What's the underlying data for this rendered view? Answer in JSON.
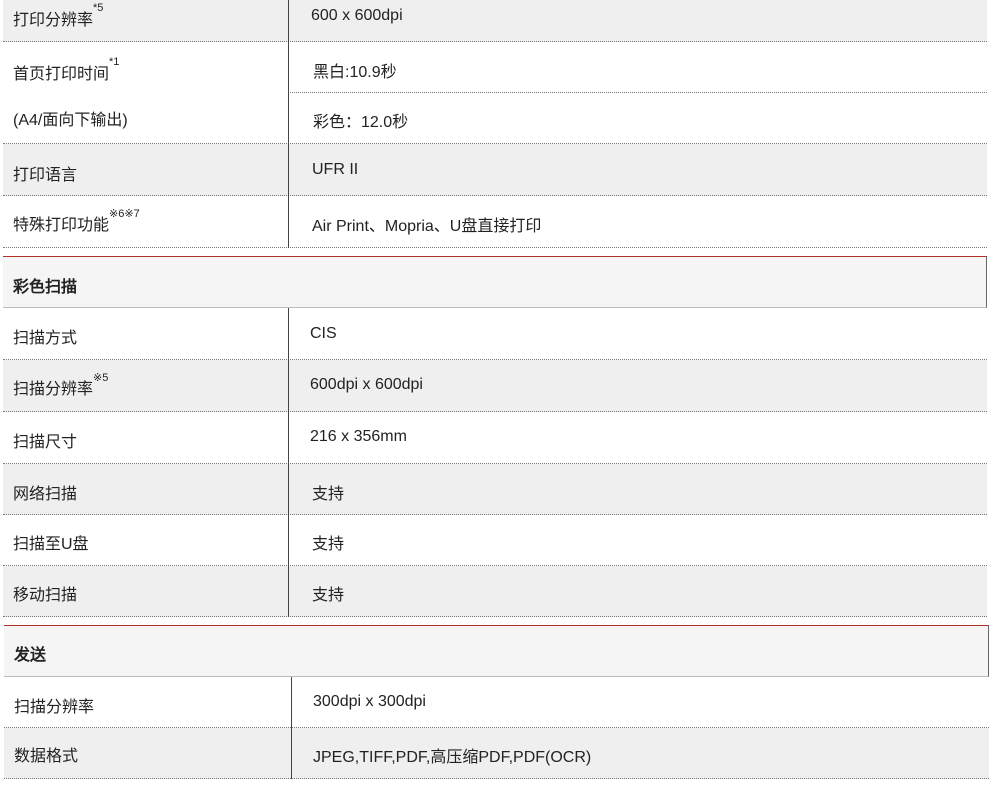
{
  "print": {
    "resolution_label": "打印分辨率",
    "resolution_note": "*5",
    "resolution_value": "600 x 600dpi",
    "first_page_label": "首页打印时间",
    "first_page_note": "*1",
    "first_page_sub": "(A4/面向下输出)",
    "first_page_bw": "黑白:10.9秒",
    "first_page_color": "彩色：12.0秒",
    "language_label": "打印语言",
    "language_value": "UFR II",
    "special_label": "特殊打印功能",
    "special_note": "※6※7",
    "special_value": "Air Print、Mopria、U盘直接打印"
  },
  "color_scan": {
    "title": "彩色扫描",
    "rows": [
      {
        "label": "扫描方式",
        "value": "CIS"
      },
      {
        "label": "扫描分辨率",
        "note": "※5",
        "value": "600dpi x 600dpi"
      },
      {
        "label": "扫描尺寸",
        "value": "216 x 356mm"
      },
      {
        "label": "网络扫描",
        "value": "支持"
      },
      {
        "label": "扫描至U盘",
        "value": "支持"
      },
      {
        "label": "移动扫描",
        "value": "支持"
      }
    ]
  },
  "send": {
    "title": "发送",
    "rows": [
      {
        "label": "扫描分辨率",
        "value": "300dpi x 300dpi"
      },
      {
        "label": "数据格式",
        "value": "JPEG,TIFF,PDF,高压缩PDF,PDF(OCR)"
      }
    ]
  }
}
